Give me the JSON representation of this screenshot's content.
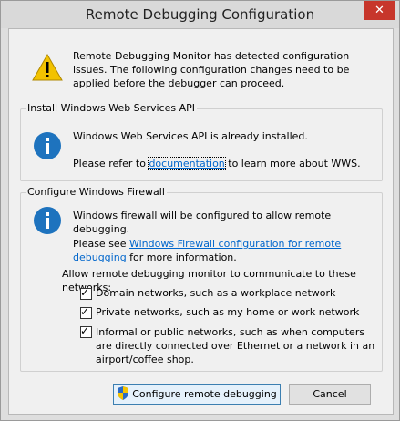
{
  "window": {
    "title": "Remote Debugging Configuration",
    "close_glyph": "✕"
  },
  "intro": {
    "icon": "warning-icon",
    "text": "Remote Debugging Monitor has detected configuration issues. The following configuration changes need to be applied before the debugger can proceed."
  },
  "wws_group": {
    "label": "Install Windows Web Services API",
    "icon": "info-icon",
    "status": "Windows Web Services API is already installed.",
    "refer_prefix": "Please refer to ",
    "refer_link": "documentation",
    "refer_suffix": " to learn more about WWS."
  },
  "firewall_group": {
    "label": "Configure Windows Firewall",
    "icon": "info-icon",
    "status": "Windows firewall will be configured to allow remote debugging.",
    "see_prefix": "Please see ",
    "see_link": "Windows Firewall configuration for remote debugging",
    "see_suffix": " for more information.",
    "allow_label": "Allow remote debugging monitor to communicate to these networks:",
    "networks": [
      {
        "label": "Domain networks, such as a workplace network",
        "checked": true
      },
      {
        "label": "Private networks, such as my home or work network",
        "checked": true
      },
      {
        "label": "Informal or public networks, such as when computers are directly connected over Ethernet or a network in an airport/coffee shop.",
        "checked": true
      }
    ]
  },
  "buttons": {
    "configure": "Configure remote debugging",
    "cancel": "Cancel"
  },
  "colors": {
    "link": "#0066cc",
    "info_blue": "#1e73be",
    "warning_yellow": "#f2c200",
    "close_red": "#c7362b"
  }
}
